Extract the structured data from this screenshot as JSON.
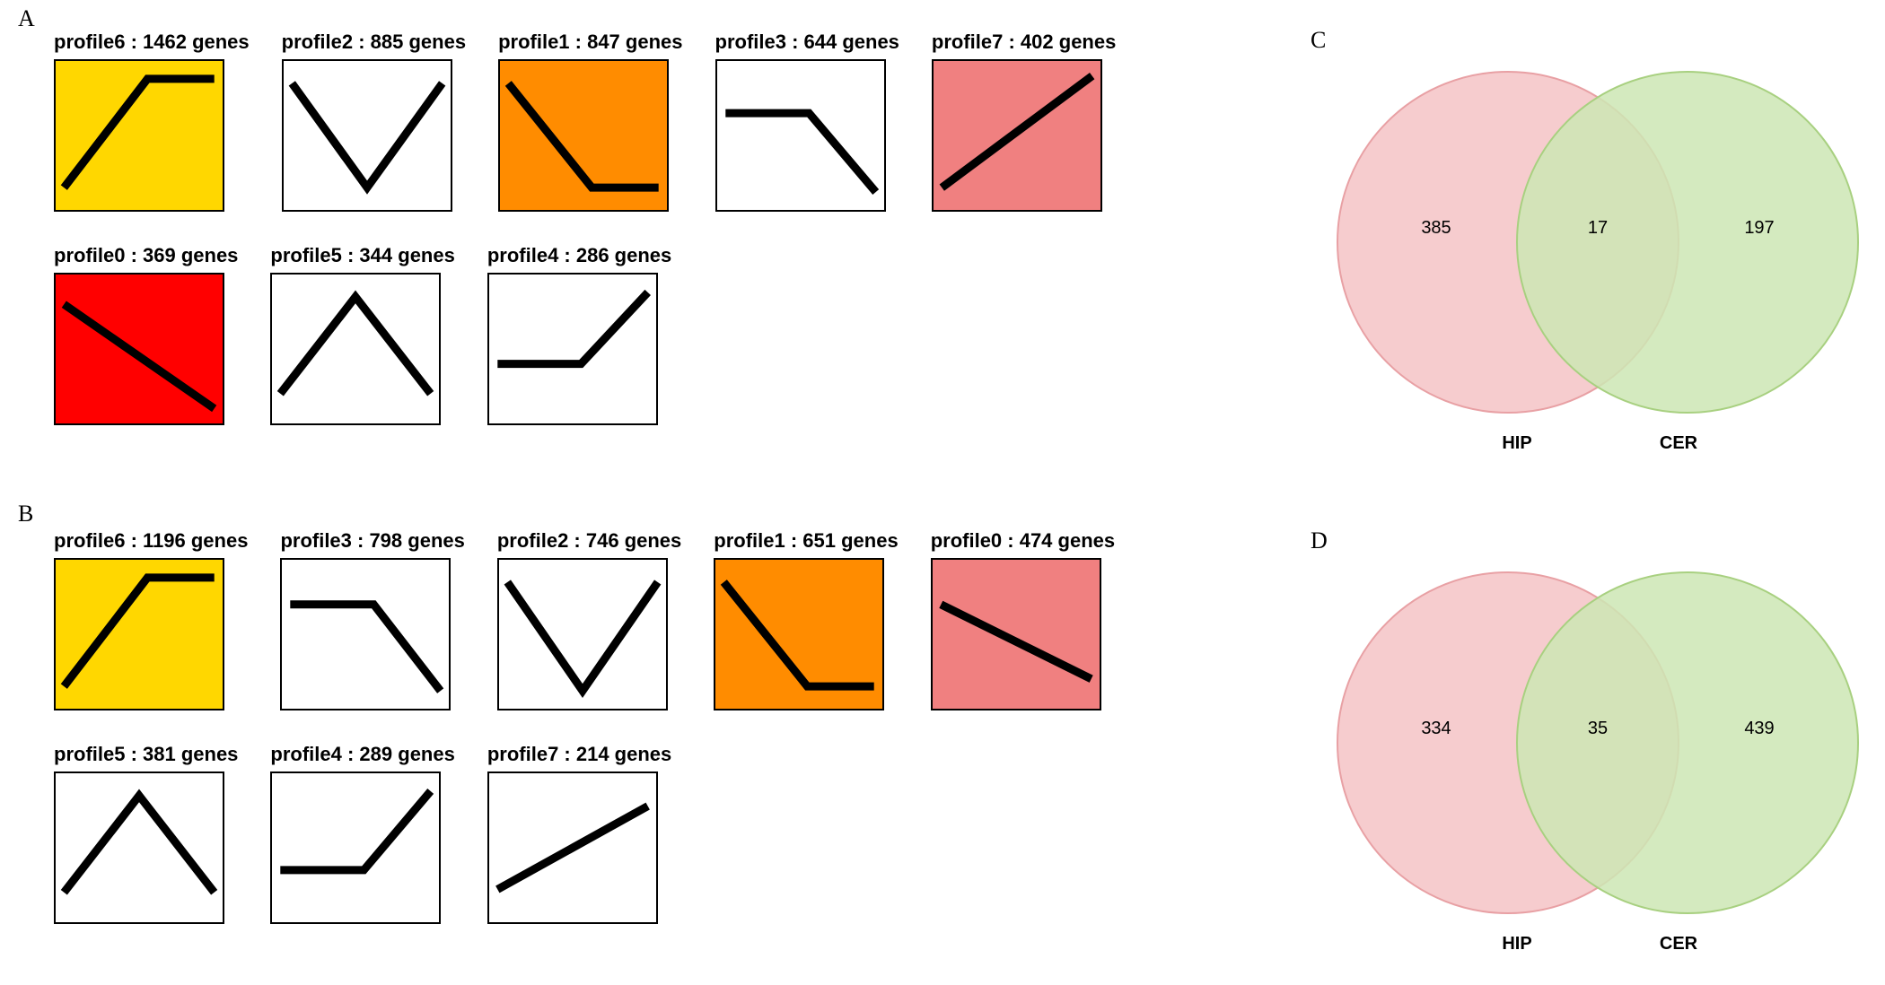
{
  "panel_labels": {
    "A": "A",
    "B": "B",
    "C": "C",
    "D": "D"
  },
  "colors": {
    "yellow": "#FFD700",
    "orange": "#FF8C00",
    "salmon": "#F08080",
    "red": "#FF0000",
    "white": "#FFFFFF",
    "venn_left_fill": "#F4C3C6",
    "venn_left_stroke": "#E8A0A4",
    "venn_right_fill": "#CDE6B4",
    "venn_right_stroke": "#A8D080"
  },
  "chart_data": {
    "panelA": {
      "rows": [
        [
          {
            "profile": 6,
            "genes": 1462,
            "fill": "yellow",
            "path": [
              [
                0.05,
                0.85
              ],
              [
                0.55,
                0.12
              ],
              [
                0.95,
                0.12
              ]
            ]
          },
          {
            "profile": 2,
            "genes": 885,
            "fill": "white",
            "path": [
              [
                0.05,
                0.15
              ],
              [
                0.5,
                0.85
              ],
              [
                0.95,
                0.15
              ]
            ]
          },
          {
            "profile": 1,
            "genes": 847,
            "fill": "orange",
            "path": [
              [
                0.05,
                0.15
              ],
              [
                0.55,
                0.85
              ],
              [
                0.95,
                0.85
              ]
            ]
          },
          {
            "profile": 3,
            "genes": 644,
            "fill": "white",
            "path": [
              [
                0.05,
                0.35
              ],
              [
                0.55,
                0.35
              ],
              [
                0.95,
                0.88
              ]
            ]
          },
          {
            "profile": 7,
            "genes": 402,
            "fill": "salmon",
            "path": [
              [
                0.05,
                0.85
              ],
              [
                0.95,
                0.1
              ]
            ]
          }
        ],
        [
          {
            "profile": 0,
            "genes": 369,
            "fill": "red",
            "path": [
              [
                0.05,
                0.2
              ],
              [
                0.95,
                0.9
              ]
            ]
          },
          {
            "profile": 5,
            "genes": 344,
            "fill": "white",
            "path": [
              [
                0.05,
                0.8
              ],
              [
                0.5,
                0.15
              ],
              [
                0.95,
                0.8
              ]
            ]
          },
          {
            "profile": 4,
            "genes": 286,
            "fill": "white",
            "path": [
              [
                0.05,
                0.6
              ],
              [
                0.55,
                0.6
              ],
              [
                0.95,
                0.12
              ]
            ]
          }
        ]
      ]
    },
    "panelB": {
      "rows": [
        [
          {
            "profile": 6,
            "genes": 1196,
            "fill": "yellow",
            "path": [
              [
                0.05,
                0.85
              ],
              [
                0.55,
                0.12
              ],
              [
                0.95,
                0.12
              ]
            ]
          },
          {
            "profile": 3,
            "genes": 798,
            "fill": "white",
            "path": [
              [
                0.05,
                0.3
              ],
              [
                0.55,
                0.3
              ],
              [
                0.95,
                0.88
              ]
            ]
          },
          {
            "profile": 2,
            "genes": 746,
            "fill": "white",
            "path": [
              [
                0.05,
                0.15
              ],
              [
                0.5,
                0.88
              ],
              [
                0.95,
                0.15
              ]
            ]
          },
          {
            "profile": 1,
            "genes": 651,
            "fill": "orange",
            "path": [
              [
                0.05,
                0.15
              ],
              [
                0.55,
                0.85
              ],
              [
                0.95,
                0.85
              ]
            ]
          },
          {
            "profile": 0,
            "genes": 474,
            "fill": "salmon",
            "path": [
              [
                0.05,
                0.3
              ],
              [
                0.95,
                0.8
              ]
            ]
          }
        ],
        [
          {
            "profile": 5,
            "genes": 381,
            "fill": "white",
            "path": [
              [
                0.05,
                0.8
              ],
              [
                0.5,
                0.15
              ],
              [
                0.95,
                0.8
              ]
            ]
          },
          {
            "profile": 4,
            "genes": 289,
            "fill": "white",
            "path": [
              [
                0.05,
                0.65
              ],
              [
                0.55,
                0.65
              ],
              [
                0.95,
                0.12
              ]
            ]
          },
          {
            "profile": 7,
            "genes": 214,
            "fill": "white",
            "path": [
              [
                0.05,
                0.78
              ],
              [
                0.95,
                0.22
              ]
            ]
          }
        ]
      ]
    },
    "panelC": {
      "type": "venn2",
      "left_label": "HIP",
      "right_label": "CER",
      "left_only": 385,
      "intersection": 17,
      "right_only": 197
    },
    "panelD": {
      "type": "venn2",
      "left_label": "HIP",
      "right_label": "CER",
      "left_only": 334,
      "intersection": 35,
      "right_only": 439
    }
  }
}
